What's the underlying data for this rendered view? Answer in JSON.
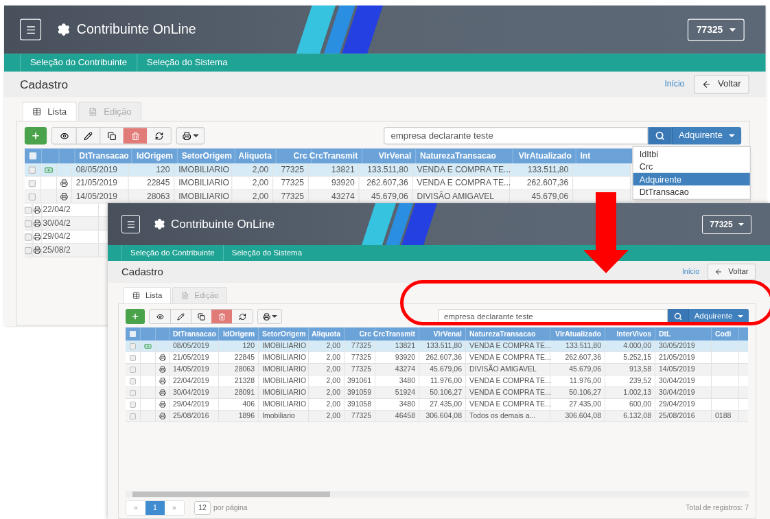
{
  "screens": [
    {
      "title": "Contribuinte OnLine",
      "user": "77325",
      "nav": [
        "Seleção do Contribuinte",
        "Seleção do Sistema"
      ],
      "page_title": "Cadastro",
      "breadcrumb": "Início",
      "back_button": "Voltar",
      "tabs": [
        {
          "label": "Lista",
          "selected": true
        },
        {
          "label": "Edição",
          "selected": false
        }
      ],
      "search": {
        "value": "empresa declarante teste"
      },
      "field_button": "Adquirente",
      "all_checked": false,
      "field_menu": [
        {
          "label": "IdItbi",
          "selected": false
        },
        {
          "label": "Crc",
          "selected": false
        },
        {
          "label": "Adquirente",
          "selected": true
        },
        {
          "label": "DtTransacao",
          "selected": false
        }
      ],
      "columns": [
        {
          "label": "DtTransacao",
          "kind": "text"
        },
        {
          "label": "IdOrigem",
          "kind": "number"
        },
        {
          "label": "SetorOrigem",
          "kind": "text"
        },
        {
          "label": "Aliquota",
          "kind": "number"
        },
        {
          "label": "Crc",
          "kind": "number"
        },
        {
          "label": "CrcTransmit",
          "kind": "number"
        },
        {
          "label": "VlrVenal",
          "kind": "number"
        },
        {
          "label": "NaturezaTransacao",
          "kind": "text"
        },
        {
          "label": "VlrAtualizado",
          "kind": "number"
        },
        {
          "label": "Int",
          "kind": "text"
        }
      ],
      "rows": [
        {
          "kind": "payment",
          "selected": true,
          "checked": false,
          "cells": [
            "08/05/2019",
            "120",
            "IMOBILIARIO",
            "2,00",
            "77325",
            "13821",
            "133.511,80",
            "VENDA E COMPRA TE...",
            "133.511,80"
          ]
        },
        {
          "kind": "print",
          "selected": false,
          "checked": false,
          "cells": [
            "21/05/2019",
            "22845",
            "IMOBILIARIO",
            "2,00",
            "77325",
            "93920",
            "262.607,36",
            "VENDA E COMPRA TE...",
            "262.607,36"
          ]
        },
        {
          "kind": "print",
          "selected": false,
          "checked": false,
          "cells": [
            "14/05/2019",
            "28063",
            "IMOBILIARIO",
            "2,00",
            "77325",
            "43274",
            "45.679,06",
            "DIVISÃO AMIGAVEL",
            "45.679,06"
          ]
        },
        {
          "kind": "print",
          "selected": false,
          "checked": false,
          "cells": [
            "22/04/2"
          ]
        },
        {
          "kind": "print",
          "selected": false,
          "checked": false,
          "cells": [
            "30/04/2"
          ]
        },
        {
          "kind": "print",
          "selected": false,
          "checked": false,
          "cells": [
            "29/04/2"
          ]
        },
        {
          "kind": "print",
          "selected": false,
          "checked": false,
          "cells": [
            "25/08/2"
          ]
        }
      ]
    },
    {
      "title": "Contribuinte OnLine",
      "user": "77325",
      "nav": [
        "Seleção do Contribuinte",
        "Seleção do Sistema"
      ],
      "page_title": "Cadastro",
      "breadcrumb": "Início",
      "back_button": "Voltar",
      "tabs": [
        {
          "label": "Lista",
          "selected": true
        },
        {
          "label": "Edição",
          "selected": false
        }
      ],
      "search": {
        "value": "empresa declarante teste"
      },
      "field_button": "Adquirente",
      "all_checked": false,
      "columns": [
        {
          "label": "DtTransacao",
          "kind": "text"
        },
        {
          "label": "IdOrigem",
          "kind": "number"
        },
        {
          "label": "SetorOrigem",
          "kind": "text"
        },
        {
          "label": "Aliquota",
          "kind": "number"
        },
        {
          "label": "Crc",
          "kind": "number"
        },
        {
          "label": "CrcTransmit",
          "kind": "number"
        },
        {
          "label": "VlrVenal",
          "kind": "number"
        },
        {
          "label": "NaturezaTransacao",
          "kind": "text"
        },
        {
          "label": "VlrAtualizado",
          "kind": "number"
        },
        {
          "label": "InterVivos",
          "kind": "number"
        },
        {
          "label": "DtL",
          "kind": "text"
        },
        {
          "label": "Codi",
          "kind": "text"
        }
      ],
      "rows": [
        {
          "kind": "payment",
          "selected": true,
          "checked": false,
          "cells": [
            "08/05/2019",
            "120",
            "IMOBILIARIO",
            "2,00",
            "77325",
            "13821",
            "133.511,80",
            "VENDA E COMPRA TE...",
            "133.511,80",
            "4.000,00",
            "30/05/2019"
          ]
        },
        {
          "kind": "print",
          "selected": false,
          "checked": false,
          "cells": [
            "21/05/2019",
            "22845",
            "IMOBILIARIO",
            "2,00",
            "77325",
            "93920",
            "262.607,36",
            "VENDA E COMPRA TE...",
            "262.607,36",
            "5.252,15",
            "21/05/2019"
          ]
        },
        {
          "kind": "print",
          "selected": false,
          "checked": false,
          "cells": [
            "14/05/2019",
            "28063",
            "IMOBILIARIO",
            "2,00",
            "77325",
            "43274",
            "45.679,06",
            "DIVISÃO AMIGAVEL",
            "45.679,06",
            "913,58",
            "14/05/2019"
          ]
        },
        {
          "kind": "print",
          "selected": false,
          "checked": false,
          "cells": [
            "22/04/2019",
            "21328",
            "IMOBILIARIO",
            "2,00",
            "391061",
            "3480",
            "11.976,00",
            "VENDA E COMPRA TE...",
            "11.976,00",
            "239,52",
            "30/04/2019"
          ]
        },
        {
          "kind": "print",
          "selected": false,
          "checked": false,
          "cells": [
            "30/04/2019",
            "28091",
            "IMOBILIARIO",
            "2,00",
            "391059",
            "51924",
            "50.106,27",
            "VENDA E COMPRA TE...",
            "50.106,27",
            "1.002,13",
            "30/04/2019"
          ]
        },
        {
          "kind": "print",
          "selected": false,
          "checked": false,
          "cells": [
            "29/04/2019",
            "406",
            "IMOBILIARIO",
            "2,00",
            "391058",
            "3480",
            "27.435,00",
            "VENDA E COMPRA TE...",
            "27.435,00",
            "600,00",
            "29/04/2019"
          ]
        },
        {
          "kind": "print",
          "selected": false,
          "checked": false,
          "cells": [
            "25/08/2016",
            "1896",
            "Imobiliario",
            "2,00",
            "77325",
            "46458",
            "306.604,08",
            "Todos os demais a...",
            "306.604,08",
            "6.132,08",
            "25/08/2016",
            "0188"
          ]
        }
      ],
      "pagination": {
        "prev": "«",
        "pages": [
          {
            "label": "1",
            "selected": true
          }
        ],
        "next": "»",
        "page_size": "12",
        "page_size_label": "por página",
        "total": "Total de registros: 7"
      }
    }
  ]
}
